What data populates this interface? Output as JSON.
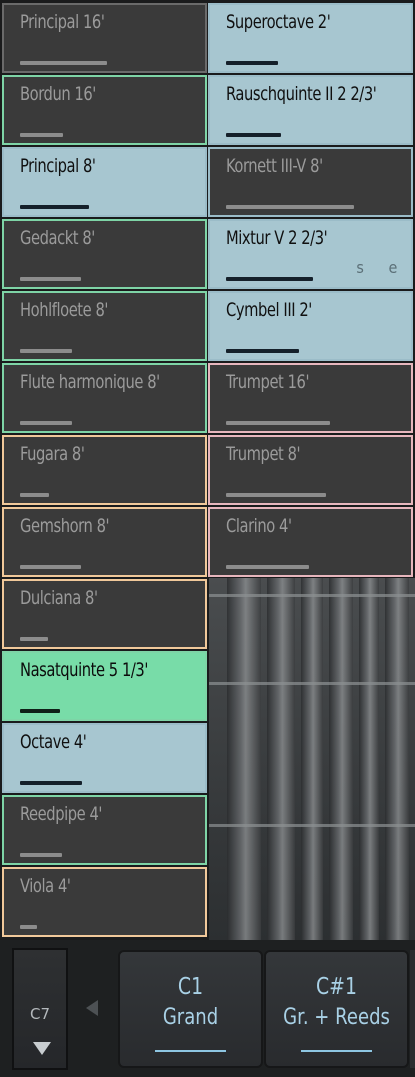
{
  "stops_left": [
    {
      "label": "Principal 16'",
      "state": "off",
      "group": "gray",
      "level": 0.5
    },
    {
      "label": "Bordun 16'",
      "state": "off",
      "group": "green",
      "level": 0.25
    },
    {
      "label": "Principal 8'",
      "state": "on",
      "group": "blue",
      "level": 0.4
    },
    {
      "label": "Gedackt 8'",
      "state": "off",
      "group": "green",
      "level": 0.35
    },
    {
      "label": "Hohlfloete 8'",
      "state": "off",
      "group": "green",
      "level": 0.3
    },
    {
      "label": "Flute harmonique 8'",
      "state": "off",
      "group": "green",
      "level": 0.3
    },
    {
      "label": "Fugara 8'",
      "state": "off",
      "group": "orange",
      "level": 0.17
    },
    {
      "label": "Gemshorn 8'",
      "state": "off",
      "group": "orange",
      "level": 0.35
    },
    {
      "label": "Dulciana 8'",
      "state": "off",
      "group": "orange",
      "level": 0.16
    },
    {
      "label": "Nasatquinte 5 1/3'",
      "state": "active",
      "group": "green",
      "level": 0.23
    },
    {
      "label": "Octave 4'",
      "state": "on",
      "group": "blue",
      "level": 0.36
    },
    {
      "label": "Reedpipe 4'",
      "state": "off",
      "group": "green",
      "level": 0.24
    },
    {
      "label": "Viola 4'",
      "state": "off",
      "group": "orange",
      "level": 0.1
    }
  ],
  "stops_right": [
    {
      "label": "Superoctave 2'",
      "state": "on",
      "group": "blue",
      "level": 0.3
    },
    {
      "label": "Rauschquinte II 2 2/3'",
      "state": "on",
      "group": "blue",
      "level": 0.32
    },
    {
      "label": "Kornett III-V 8'",
      "state": "off",
      "group": "blue",
      "level": 0.74
    },
    {
      "label": "Mixtur V 2 2/3'",
      "state": "on",
      "group": "blue",
      "level": 0.5,
      "tags": [
        "s",
        "e"
      ]
    },
    {
      "label": "Cymbel III 2'",
      "state": "on",
      "group": "blue",
      "level": 0.42
    },
    {
      "label": "Trumpet 16'",
      "state": "off",
      "group": "pink",
      "level": 0.6
    },
    {
      "label": "Trumpet 8'",
      "state": "off",
      "group": "pink",
      "level": 0.58
    },
    {
      "label": "Clarino 4'",
      "state": "off",
      "group": "pink",
      "level": 0.48
    }
  ],
  "footer": {
    "page_label": "C7",
    "combinations": [
      {
        "key": "C1",
        "name": "Grand"
      },
      {
        "key": "C#1",
        "name": "Gr. + Reeds"
      }
    ]
  },
  "icons": {
    "page_down": "triangle-down-icon",
    "prev": "triangle-left-icon"
  }
}
